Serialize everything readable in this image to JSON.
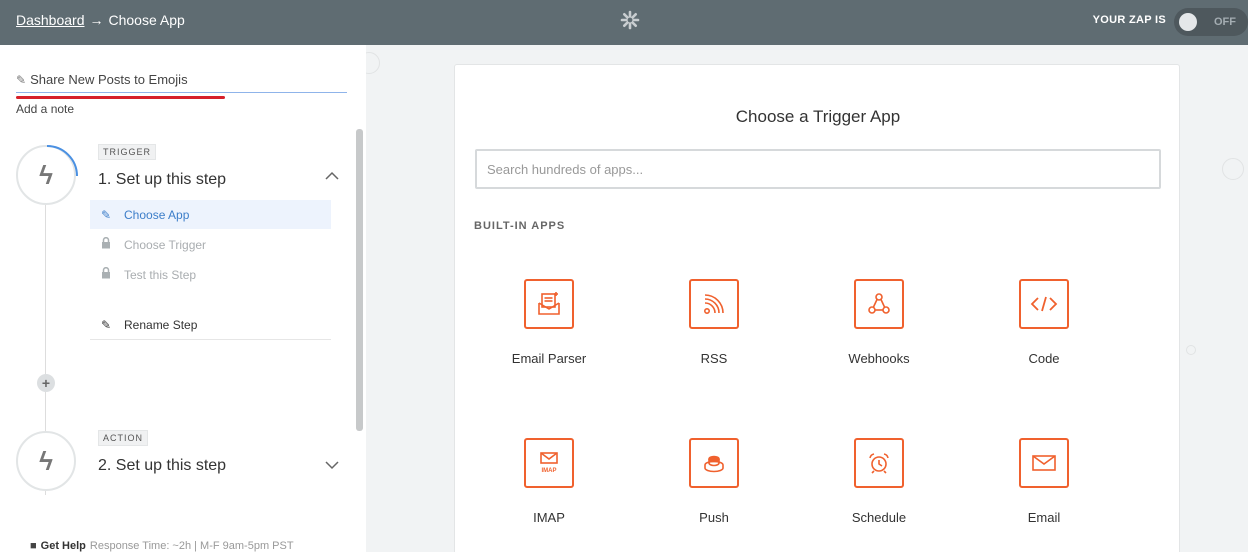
{
  "topbar": {
    "breadcrumb_link": "Dashboard",
    "breadcrumb_arrow": "→",
    "breadcrumb_current": "Choose App",
    "zap_status_label": "YOUR ZAP IS",
    "toggle_label": "OFF"
  },
  "sidebar": {
    "zap_name": "Share New Posts to Emojis",
    "add_note": "Add a note",
    "steps": [
      {
        "badge": "TRIGGER",
        "title": "1. Set up this step",
        "substeps": [
          "Choose App",
          "Choose Trigger",
          "Test this Step",
          "Rename Step"
        ]
      },
      {
        "badge": "ACTION",
        "title": "2. Set up this step"
      }
    ],
    "help_title": "Get Help",
    "help_text": "Response Time: ~2h | M-F 9am-5pm PST"
  },
  "main": {
    "title": "Choose a Trigger App",
    "search_placeholder": "Search hundreds of apps...",
    "section_label": "BUILT-IN APPS",
    "apps": [
      {
        "name": "Email Parser",
        "icon": "email-parser-icon"
      },
      {
        "name": "RSS",
        "icon": "rss-icon"
      },
      {
        "name": "Webhooks",
        "icon": "webhooks-icon"
      },
      {
        "name": "Code",
        "icon": "code-icon"
      },
      {
        "name": "IMAP",
        "icon": "imap-icon"
      },
      {
        "name": "Push",
        "icon": "push-icon"
      },
      {
        "name": "Schedule",
        "icon": "schedule-icon"
      },
      {
        "name": "Email",
        "icon": "email-icon"
      }
    ]
  },
  "colors": {
    "topbar": "#5f6c72",
    "accent_orange": "#f0612e",
    "active_blue": "#3d7ec9",
    "red_underline": "#d6202a"
  }
}
